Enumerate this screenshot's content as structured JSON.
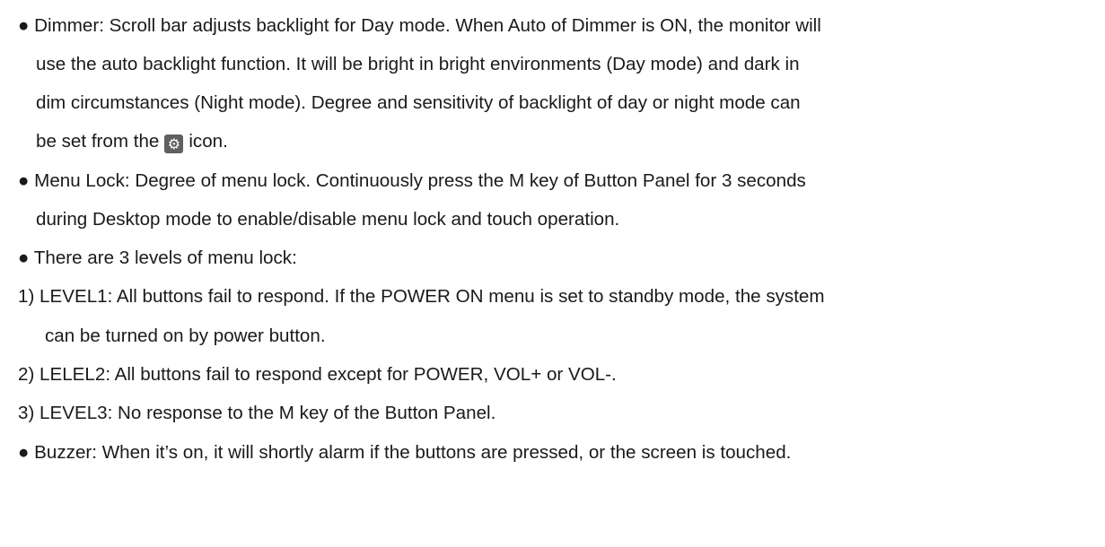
{
  "doc": {
    "dimmer": {
      "line1": "● Dimmer: Scroll bar adjusts backlight for Day mode. When Auto of Dimmer is ON, the monitor will",
      "line2": "use the auto backlight function. It will be bright in bright environments (Day mode) and dark in",
      "line3": "dim circumstances (Night mode). Degree and sensitivity of backlight of day or night mode can",
      "line4_before_icon": "be set from the",
      "line4_icon": "gear-icon",
      "line4_after_icon": "icon."
    },
    "menu_lock": {
      "line1": "● Menu Lock: Degree of menu lock. Continuously press the M key of Button Panel for 3 seconds",
      "line2": "during Desktop mode to enable/disable menu lock and touch operation."
    },
    "levels_intro": "● There are 3 levels of menu lock:",
    "level1": {
      "line1": "1) LEVEL1: All buttons fail to respond. If the POWER ON menu is set to standby mode, the system",
      "line2": "can be turned on by power button."
    },
    "level2": "2) LELEL2: All buttons fail to respond except for POWER, VOL+ or VOL-.",
    "level3": "3) LEVEL3: No response to the M key of the Button Panel.",
    "buzzer": "● Buzzer: When it’s on, it will shortly alarm if the buttons are pressed, or the screen is touched."
  }
}
